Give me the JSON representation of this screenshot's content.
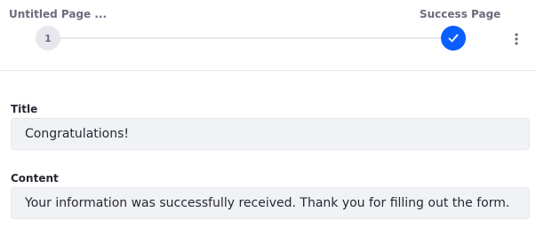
{
  "stepper": {
    "steps": [
      {
        "label": "Untitled Page ...",
        "marker": "1",
        "state": "pending"
      },
      {
        "label": "Success Page",
        "marker": "check-icon",
        "state": "completed"
      }
    ],
    "active_color": "#0b5fff"
  },
  "menu": {
    "icon": "kebab-menu-icon"
  },
  "fields": {
    "title": {
      "label": "Title",
      "value": "Congratulations!"
    },
    "content": {
      "label": "Content",
      "value": "Your information was successfully received. Thank you for filling out the form."
    }
  }
}
